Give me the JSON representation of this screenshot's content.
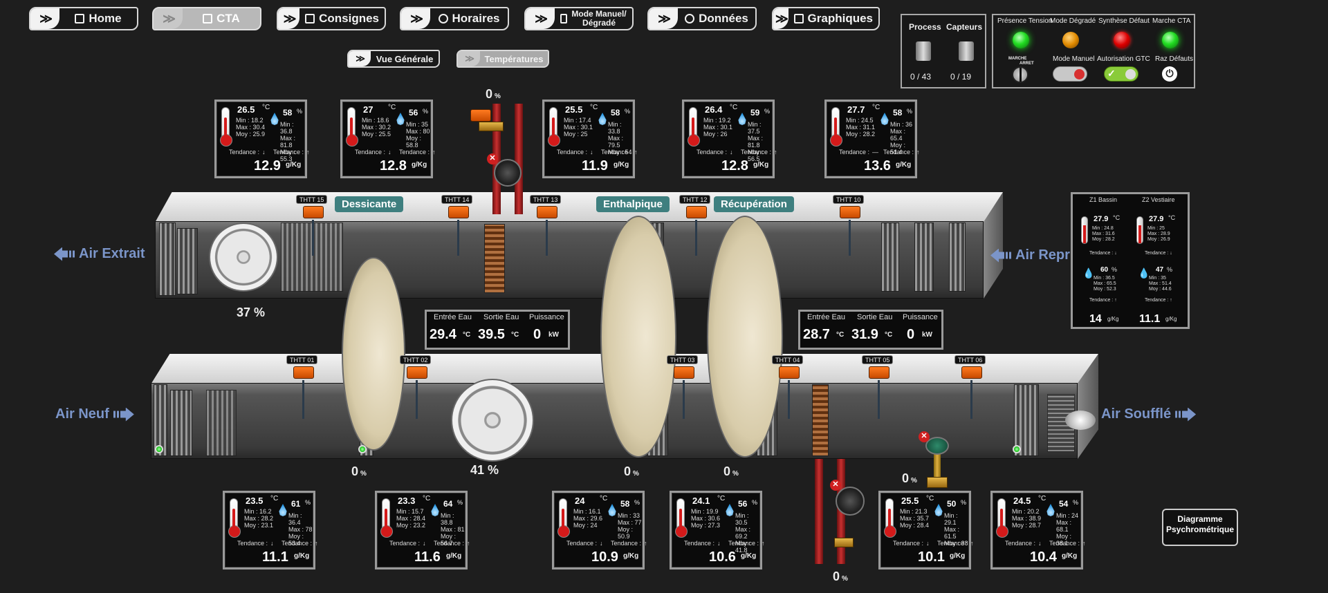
{
  "nav": {
    "items": [
      {
        "key": "home",
        "label": "Home",
        "icon": "home-icon"
      },
      {
        "key": "cta",
        "label": "CTA",
        "icon": "building-icon",
        "active": true
      },
      {
        "key": "consignes",
        "label": "Consignes",
        "icon": "sliders-icon"
      },
      {
        "key": "horaires",
        "label": "Horaires",
        "icon": "clock-icon"
      },
      {
        "key": "mode",
        "label": "Mode Manuel/ Dégradé",
        "icon": "tools-icon"
      },
      {
        "key": "donnees",
        "label": "Données",
        "icon": "search-icon"
      },
      {
        "key": "graphiques",
        "label": "Graphiques",
        "icon": "chart-icon"
      }
    ],
    "sub": [
      {
        "label": "Vue Générale",
        "active": false
      },
      {
        "label": "Températures",
        "active": true
      }
    ],
    "chevron": "≫"
  },
  "process_panel": {
    "process_label": "Process",
    "capteurs_label": "Capteurs",
    "process_value": "0 / 43",
    "capteurs_value": "0 / 19"
  },
  "status_panel": {
    "presence_tension": "Présence Tension",
    "mode_degrade": "Mode Dégradé",
    "synthese_defaut": "Synthèse Défaut",
    "marche_cta": "Marche CTA",
    "mode_manuel": "Mode Manuel",
    "autorisation_gtc": "Autorisation GTC",
    "raz_defauts": "Raz Défauts",
    "marche": "MARCHE",
    "arret": "ARRET"
  },
  "sensors": {
    "tend_t": "Tendance :",
    "tend_h": "Tendance :",
    "unit_abs": "g/Kg",
    "unit_t": "°C",
    "unit_h": "%",
    "top": [
      {
        "t": "26.5",
        "tmin": "Min : 18.2",
        "tmax": "Max : 30.4",
        "tmoy": "Moy : 25.9",
        "h": "58",
        "hmin": "Min : 36.8",
        "hmax": "Max : 81.8",
        "hmoy": "Moy : 55.3",
        "tt": "↓",
        "th": "↑",
        "abs": "12.9"
      },
      {
        "t": "27",
        "tmin": "Min : 18.6",
        "tmax": "Max : 30.2",
        "tmoy": "Moy : 25.5",
        "h": "56",
        "hmin": "Min : 35",
        "hmax": "Max : 80",
        "hmoy": "Moy : 58.8",
        "tt": "↓",
        "th": "↑",
        "abs": "12.8"
      },
      {
        "t": "25.5",
        "tmin": "Min : 17.4",
        "tmax": "Max : 30.1",
        "tmoy": "Moy : 25",
        "h": "58",
        "hmin": "Min : 33.8",
        "hmax": "Max : 79.5",
        "hmoy": "Moy : 54",
        "tt": "↓",
        "th": "↑",
        "abs": "11.9"
      },
      {
        "t": "26.4",
        "tmin": "Min : 19.2",
        "tmax": "Max : 30.1",
        "tmoy": "Moy : 26",
        "h": "59",
        "hmin": "Min : 37.5",
        "hmax": "Max : 81.8",
        "hmoy": "Moy : 56.5",
        "tt": "↓",
        "th": "↑",
        "abs": "12.8"
      },
      {
        "t": "27.7",
        "tmin": "Min : 24.5",
        "tmax": "Max : 31.1",
        "tmoy": "Moy : 28.2",
        "h": "58",
        "hmin": "Min : 36",
        "hmax": "Max : 65.4",
        "hmoy": "Moy : 51.4",
        "tt": "—",
        "th": "↑",
        "abs": "13.6"
      }
    ],
    "bottom": [
      {
        "t": "23.5",
        "tmin": "Min : 16.2",
        "tmax": "Max : 28.2",
        "tmoy": "Moy : 23.1",
        "h": "61",
        "hmin": "Min : 36.4",
        "hmax": "Max : 78",
        "hmoy": "Moy : 53.4",
        "tt": "↓",
        "th": "↑",
        "abs": "11.1"
      },
      {
        "t": "23.3",
        "tmin": "Min : 15.7",
        "tmax": "Max : 28.4",
        "tmoy": "Moy : 23.2",
        "h": "64",
        "hmin": "Min : 38.8",
        "hmax": "Max : 81",
        "hmoy": "Moy : 56.7",
        "tt": "↓",
        "th": "↑",
        "abs": "11.6"
      },
      {
        "t": "24",
        "tmin": "Min : 16.1",
        "tmax": "Max : 29.6",
        "tmoy": "Moy : 24",
        "h": "58",
        "hmin": "Min : 33",
        "hmax": "Max : 77",
        "hmoy": "Moy : 50.9",
        "tt": "↓",
        "th": "↑",
        "abs": "10.9"
      },
      {
        "t": "24.1",
        "tmin": "Min : 19.9",
        "tmax": "Max : 30.6",
        "tmoy": "Moy : 27.3",
        "h": "56",
        "hmin": "Min : 30.5",
        "hmax": "Max : 69.2",
        "hmoy": "Moy : 41.8",
        "tt": "↓",
        "th": "↑",
        "abs": "10.6"
      },
      {
        "t": "25.5",
        "tmin": "Min : 21.3",
        "tmax": "Max : 35.7",
        "tmoy": "Moy : 28.4",
        "h": "50",
        "hmin": "Min : 29.1",
        "hmax": "Max : 61.5",
        "hmoy": "Moy : 38",
        "tt": "↓",
        "th": "↑",
        "abs": "10.1"
      },
      {
        "t": "24.5",
        "tmin": "Min : 20.2",
        "tmax": "Max : 38.9",
        "tmoy": "Moy : 28.7",
        "h": "54",
        "hmin": "Min : 24",
        "hmax": "Max : 68.1",
        "hmoy": "Moy : 38.1",
        "tt": "↓",
        "th": "↑",
        "abs": "10.4"
      }
    ]
  },
  "labels": {
    "dessicante": "Dessicante",
    "enthalpique": "Enthalpique",
    "recuperation": "Récupération",
    "air_extrait": "Air Extrait",
    "air_repris": "Air Repris",
    "air_neuf": "Air Neuf",
    "air_souffle": "Air Soufflé"
  },
  "tags": [
    "THTT 15",
    "THTT 14",
    "THTT 13",
    "THTT 12",
    "THTT 10",
    "THTT 01",
    "THTT 02",
    "THTT 03",
    "THTT 04",
    "THTT 05",
    "THTT 06"
  ],
  "percents": {
    "valve_top": "0",
    "fan_extract": "37 %",
    "fan_supply": "41 %",
    "wheel1": "0",
    "wheel2": "0",
    "wheel3": "0",
    "valve_bottom_right": "0",
    "valve_bottom": "0",
    "unit": "%"
  },
  "water": {
    "entree_label": "Entrée Eau",
    "sortie_label": "Sortie Eau",
    "puissance_label": "Puissance",
    "unit_t": "°C",
    "unit_p": "kW",
    "left": {
      "entree": "29.4",
      "sortie": "39.5",
      "puissance": "0"
    },
    "right": {
      "entree": "28.7",
      "sortie": "31.9",
      "puissance": "0"
    }
  },
  "zones": {
    "z1": "Z1 Bassin",
    "z2": "Z2 Vestiaire",
    "z1_t": "27.9",
    "z2_t": "27.9",
    "z1_tmin": "Min : 24.8",
    "z1_tmax": "Max : 31.6",
    "z1_tmoy": "Moy : 28.2",
    "z2_tmin": "Min : 25",
    "z2_tmax": "Max : 28.9",
    "z2_tmoy": "Moy : 26.9",
    "z1_h": "60",
    "z2_h": "47",
    "z1_hmin": "Min : 36.5",
    "z1_hmax": "Max : 65.5",
    "z1_hmoy": "Moy : 52.3",
    "z2_hmin": "Min : 35",
    "z2_hmax": "Max : 51.4",
    "z2_hmoy": "Moy : 44.6",
    "tend": "Tendance :",
    "z1_tt": "↓",
    "z2_tt": "↓",
    "z1_th": "↑",
    "z2_th": "↑",
    "z1_abs": "14",
    "z2_abs": "11.1",
    "unit_abs": "g/Kg",
    "unit_t": "°C",
    "unit_h": "%"
  },
  "diagram_button": "Diagramme Psychrométrique"
}
